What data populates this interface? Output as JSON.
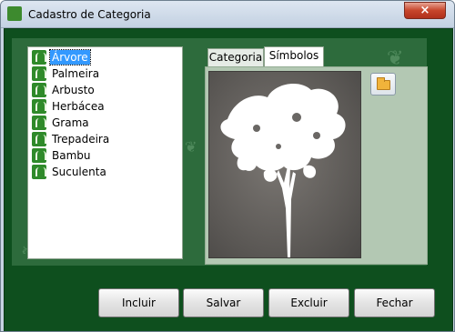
{
  "window": {
    "title": "Cadastro de Categoria",
    "close_label": "×"
  },
  "categories": [
    {
      "label": "Árvore",
      "selected": true,
      "icon": "tree-icon"
    },
    {
      "label": "Palmeira",
      "selected": false,
      "icon": "palm-icon"
    },
    {
      "label": "Arbusto",
      "selected": false,
      "icon": "shrub-icon"
    },
    {
      "label": "Herbácea",
      "selected": false,
      "icon": "herbaceous-icon"
    },
    {
      "label": "Grama",
      "selected": false,
      "icon": "grass-icon"
    },
    {
      "label": "Trepadeira",
      "selected": false,
      "icon": "climber-icon"
    },
    {
      "label": "Bambu",
      "selected": false,
      "icon": "bamboo-icon"
    },
    {
      "label": "Suculenta",
      "selected": false,
      "icon": "succulent-icon"
    }
  ],
  "tabs": [
    {
      "label": "Categoria",
      "active": false
    },
    {
      "label": "Símbolos",
      "active": true
    }
  ],
  "symbol_panel": {
    "image": "tree-silhouette",
    "folder_button_icon": "folder-icon"
  },
  "buttons": {
    "include": "Incluir",
    "save": "Salvar",
    "delete": "Excluir",
    "close": "Fechar"
  },
  "colors": {
    "background": "#0e4f1e",
    "panel": "#2d6b3c",
    "selection": "#3399ff",
    "icon_green": "#2f8a2a"
  }
}
